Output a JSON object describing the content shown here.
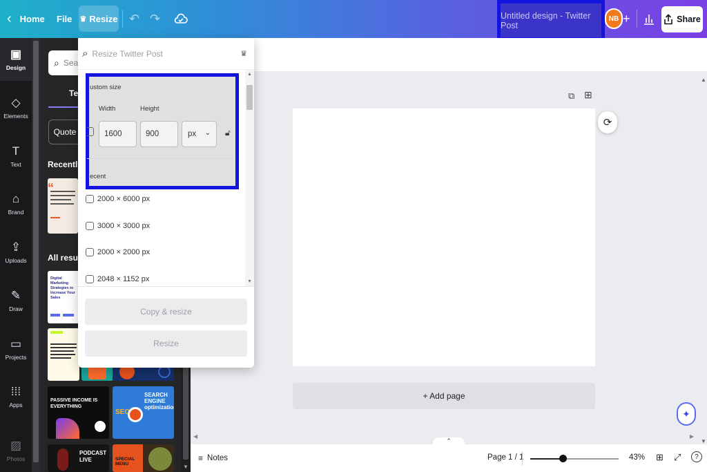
{
  "topbar": {
    "home_label": "Home",
    "file_label": "File",
    "resize_label": "Resize",
    "title": "Untitled design - Twitter Post",
    "avatar_initials": "NB",
    "share_label": "Share"
  },
  "rail": {
    "items": [
      {
        "label": "Design",
        "icon": "layout-icon"
      },
      {
        "label": "Elements",
        "icon": "shapes-icon"
      },
      {
        "label": "Text",
        "icon": "text-icon"
      },
      {
        "label": "Brand",
        "icon": "brand-icon"
      },
      {
        "label": "Uploads",
        "icon": "upload-icon"
      },
      {
        "label": "Draw",
        "icon": "pen-icon"
      },
      {
        "label": "Projects",
        "icon": "folder-icon"
      },
      {
        "label": "Apps",
        "icon": "apps-icon"
      },
      {
        "label": "Photos",
        "icon": "photo-icon"
      }
    ]
  },
  "panel": {
    "search_placeholder": "Sear",
    "tab_label": "Ter",
    "quote_chip": "Quote",
    "recently_heading": "Recently u",
    "all_results_heading": "All results",
    "templates": [
      {
        "title": "Digital Marketing Strategies to Increase Your Sales"
      },
      {
        "title": "PASSIVE INCOME IS EVERYTHING"
      },
      {
        "title": "SEARCH ENGINE optimization",
        "badge": "SEO"
      },
      {
        "title": "PODCAST LIVE"
      },
      {
        "title": "SPECIAL MENU"
      }
    ]
  },
  "resize_dropdown": {
    "search_placeholder": "Resize Twitter Post",
    "custom_size_label": "ustom size",
    "width_label": "Width",
    "height_label": "Height",
    "width_value": "1600",
    "height_value": "900",
    "unit_value": "px",
    "recent_label": "ecent",
    "recent_sizes": [
      "2000 × 6000 px",
      "3000 × 3000 px",
      "2000 × 2000 px",
      "2048 × 1152 px"
    ],
    "copy_resize_label": "Copy & resize",
    "resize_label": "Resize"
  },
  "canvas": {
    "add_page_label": "+ Add page"
  },
  "bottombar": {
    "notes_label": "Notes",
    "page_indicator": "Page 1 / 1",
    "zoom_label": "43%",
    "zoom_fraction": 0.37
  },
  "colors": {
    "highlight_border": "#1414e0",
    "topbar_start": "#1eb0c9",
    "topbar_end": "#7b3fe4"
  }
}
